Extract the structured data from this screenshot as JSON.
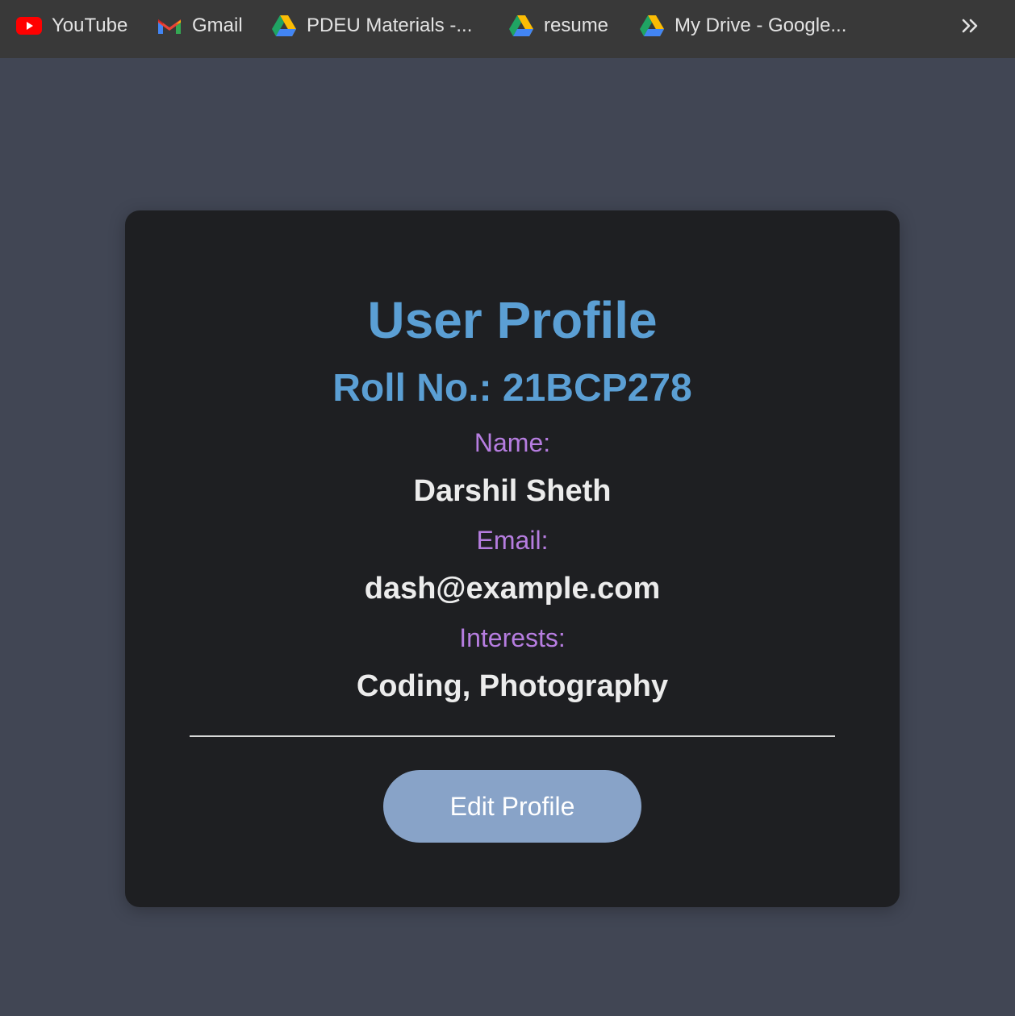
{
  "bookmarks": [
    {
      "label": "YouTube",
      "icon": "youtube-icon"
    },
    {
      "label": "Gmail",
      "icon": "gmail-icon"
    },
    {
      "label": "PDEU Materials -...",
      "icon": "google-drive-icon"
    },
    {
      "label": "resume",
      "icon": "google-drive-icon"
    },
    {
      "label": "My Drive - Google...",
      "icon": "google-drive-icon"
    }
  ],
  "overflow_icon": "double-chevron-right-icon",
  "profile": {
    "title": "User Profile",
    "roll_no": "Roll No.: 21BCP278",
    "name_label": "Name:",
    "name_value": "Darshil Sheth",
    "email_label": "Email:",
    "email_value": "dash@example.com",
    "interests_label": "Interests:",
    "interests_value": "Coding, Photography",
    "edit_button_label": "Edit Profile"
  },
  "colors": {
    "page_background": "#414654",
    "bookmarks_bar": "#393939",
    "card_background": "#1e1f22",
    "heading": "#5b9fd4",
    "label": "#b67de0",
    "value": "#ececec",
    "button": "#88a3c8"
  }
}
